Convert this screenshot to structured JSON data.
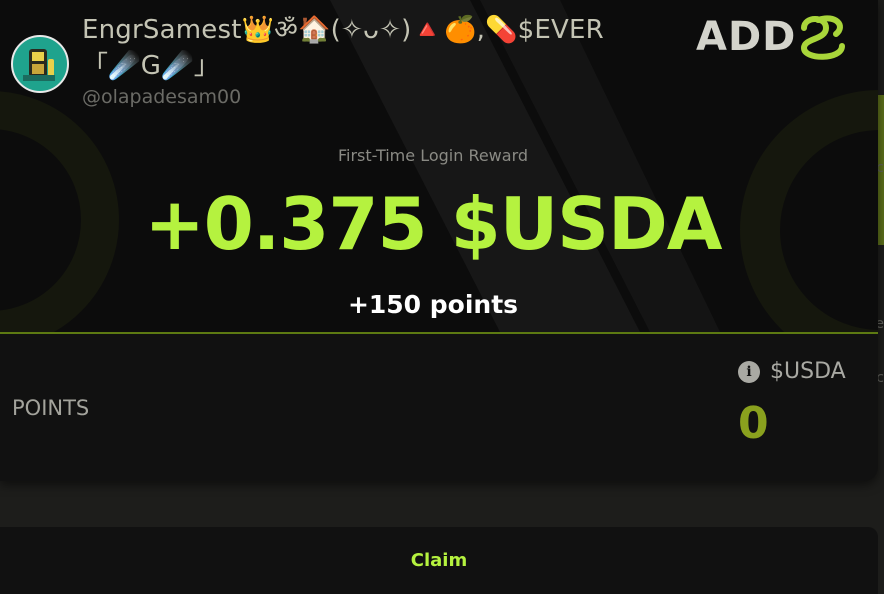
{
  "user": {
    "display_name": "EngrSamest👑ॐ🏠(✧ᴗ✧)🔺🍊,💊$EVER 「☄️G☄️」",
    "handle": "@olapadesam00"
  },
  "brand": {
    "name": "ADD"
  },
  "reward": {
    "label": "First-Time Login Reward",
    "amount": "+0.375 $USDA",
    "points": "+150 points"
  },
  "stats": {
    "points_label": "POINTS",
    "usda_label": "$USDA",
    "usda_value": "0",
    "info_icon": "i"
  },
  "actions": {
    "claim_label": "Claim"
  },
  "colors": {
    "accent": "#b5f23f",
    "muted_accent": "#8aa11e",
    "card_bg": "#111111",
    "page_bg": "#1d1d1b"
  },
  "icons": [
    "info-icon",
    "brand-logo-icon",
    "avatar"
  ]
}
